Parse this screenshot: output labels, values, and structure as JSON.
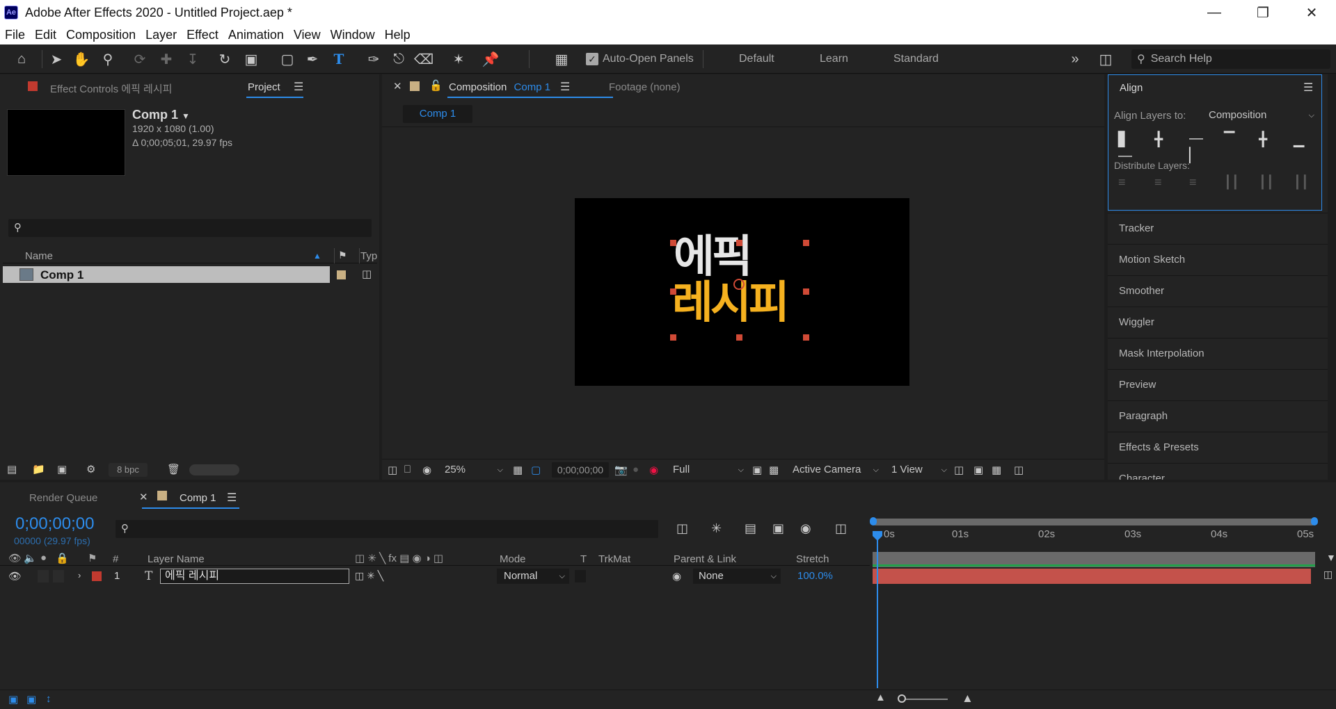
{
  "window": {
    "title": "Adobe After Effects 2020 - Untitled Project.aep *",
    "app_icon": "Ae"
  },
  "menu": [
    "File",
    "Edit",
    "Composition",
    "Layer",
    "Effect",
    "Animation",
    "View",
    "Window",
    "Help"
  ],
  "toolbar": {
    "auto_open_label": "Auto-Open Panels",
    "workspaces": [
      "Default",
      "Learn",
      "Standard"
    ],
    "search_placeholder": "Search Help"
  },
  "project_panel": {
    "effect_controls_tab": "Effect Controls",
    "effect_controls_layer": "에픽 레시피",
    "project_tab": "Project",
    "comp_name": "Comp 1",
    "comp_resolution": "1920 x 1080 (1.00)",
    "comp_duration": "Δ 0;00;05;01, 29.97 fps",
    "columns": {
      "name": "Name",
      "type": "Typ"
    },
    "items": [
      {
        "name": "Comp 1"
      }
    ],
    "bpc": "8 bpc"
  },
  "composition_panel": {
    "tab_label": "Composition",
    "tab_comp": "Comp 1",
    "footage_label": "Footage",
    "footage_value": "(none)",
    "viewer_tab": "Comp 1",
    "canvas_text_line1": "에픽",
    "canvas_text_line2": "레시피",
    "zoom": "25%",
    "timecode": "0;00;00;00",
    "resolution": "Full",
    "camera": "Active Camera",
    "views": "1 View"
  },
  "align_panel": {
    "title": "Align",
    "align_to_label": "Align Layers to:",
    "align_to_value": "Composition",
    "distribute_label": "Distribute Layers:"
  },
  "right_panels": [
    "Tracker",
    "Motion Sketch",
    "Smoother",
    "Wiggler",
    "Mask Interpolation",
    "Preview",
    "Paragraph",
    "Effects & Presets",
    "Character"
  ],
  "timeline": {
    "render_queue_tab": "Render Queue",
    "comp_tab": "Comp 1",
    "timecode": "0;00;00;00",
    "frame_info": "00000 (29.97 fps)",
    "columns": {
      "num": "#",
      "layer_name": "Layer Name",
      "mode": "Mode",
      "t": "T",
      "trkmat": "TrkMat",
      "parent": "Parent & Link",
      "stretch": "Stretch"
    },
    "ruler": [
      "0s",
      "01s",
      "02s",
      "03s",
      "04s",
      "05s"
    ],
    "layers": [
      {
        "num": "1",
        "type_icon": "T",
        "name": "에픽 레시피",
        "mode": "Normal",
        "parent": "None",
        "stretch": "100.0%"
      }
    ]
  },
  "colors": {
    "accent": "#2d8ceb",
    "layer_bar": "#c4524b",
    "text_white": "#e6e6e6",
    "text_yellow": "#f5b11f"
  }
}
